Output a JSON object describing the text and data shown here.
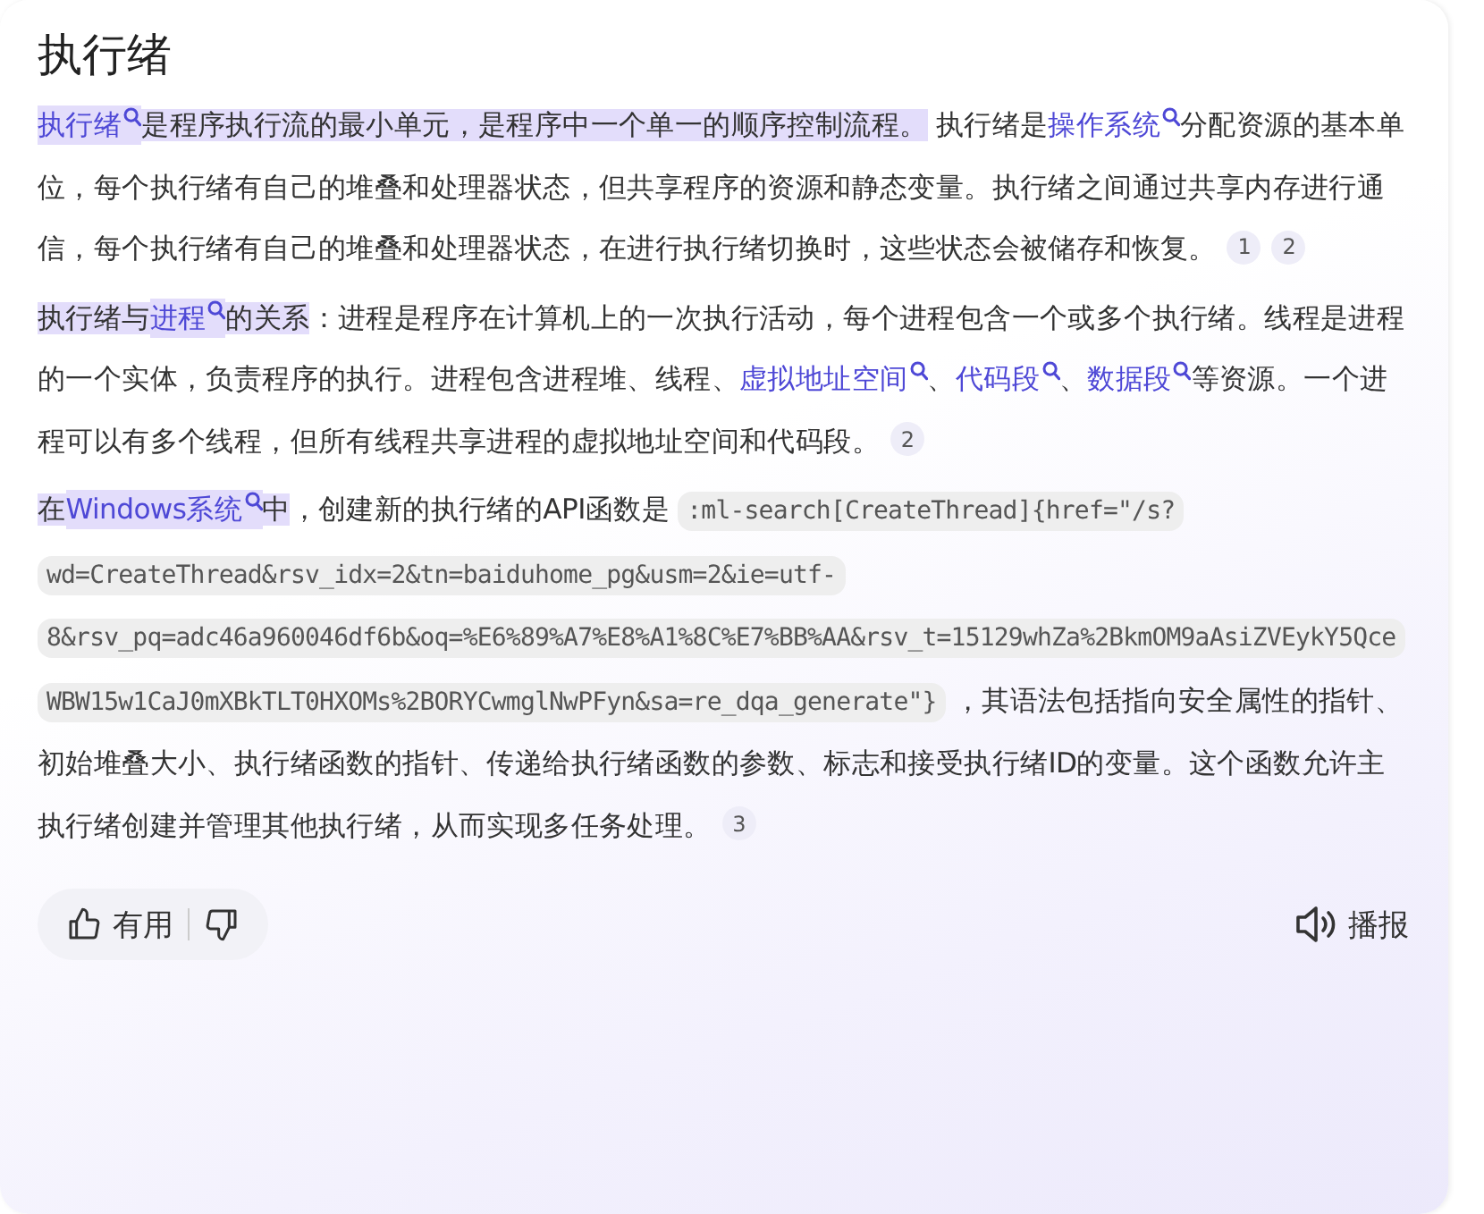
{
  "title": "执行绪",
  "paragraphs": [
    {
      "segments": [
        {
          "kind": "link",
          "text": "执行绪",
          "highlight": true
        },
        {
          "kind": "text",
          "text": "是程序执行流的最小单元，是程序中一个单一的顺序控制流程。",
          "highlight": true
        },
        {
          "kind": "text",
          "text": " 执行绪是",
          "highlight": false
        },
        {
          "kind": "link",
          "text": "操作系统",
          "highlight": false
        },
        {
          "kind": "text",
          "text": "分配资源的基本单位，每个执行绪有自己的堆叠和处理器状态，但共享程序的资源和静态变量。执行绪之间通过共享内存进行通信，每个执行绪有自己的堆叠和处理器状态，在进行执行绪切换时，这些状态会被储存和恢复。",
          "highlight": false
        }
      ],
      "citations": [
        "1",
        "2"
      ]
    },
    {
      "segments": [
        {
          "kind": "text",
          "text": "执行绪与",
          "highlight": true
        },
        {
          "kind": "link",
          "text": "进程",
          "highlight": true
        },
        {
          "kind": "text",
          "text": "的关系",
          "highlight": true
        },
        {
          "kind": "text",
          "text": "：进程是程序在计算机上的一次执行活动，每个进程包含一个或多个执行绪。线程是进程的一个实体，负责程序的执行。进程包含进程堆、线程、",
          "highlight": false
        },
        {
          "kind": "link",
          "text": "虚拟地址空间",
          "highlight": false
        },
        {
          "kind": "text",
          "text": "、",
          "highlight": false
        },
        {
          "kind": "link",
          "text": "代码段",
          "highlight": false
        },
        {
          "kind": "text",
          "text": "、",
          "highlight": false
        },
        {
          "kind": "link",
          "text": "数据段",
          "highlight": false
        },
        {
          "kind": "text",
          "text": "等资源。一个进程可以有多个线程，但所有线程共享进程的虚拟地址空间和代码段。",
          "highlight": false
        }
      ],
      "citations": [
        "2"
      ]
    },
    {
      "segments": [
        {
          "kind": "text",
          "text": "在",
          "highlight": true
        },
        {
          "kind": "link",
          "text": "Windows系统",
          "highlight": true
        },
        {
          "kind": "text",
          "text": "中",
          "highlight": true
        },
        {
          "kind": "text",
          "text": "，创建新的执行绪的API函数是 ",
          "highlight": false
        },
        {
          "kind": "code",
          "text": ":ml-search[CreateThread]{href=\"/s?wd=CreateThread&rsv_idx=2&tn=baiduhome_pg&usm=2&ie=utf-8&rsv_pq=adc46a960046df6b&oq=%E6%89%A7%E8%A1%8C%E7%BB%AA&rsv_t=15129whZa%2BkmOM9aAsiZVEykY5QceWBW15w1CaJ0mXBkTLT0HXOMs%2BORYCwmglNwPFyn&sa=re_dqa_generate\"}"
        },
        {
          "kind": "text",
          "text": " ，其语法包括指向安全属性的指针、初始堆叠大小、执行绪函数的指针、传递给执行绪函数的参数、标志和接受执行绪ID的变量。这个函数允许主执行绪创建并管理其他执行绪，从而实现多任务处理。",
          "highlight": false
        }
      ],
      "citations": [
        "3"
      ]
    }
  ],
  "feedback": {
    "useful_label": "有用"
  },
  "play_label": "播报"
}
